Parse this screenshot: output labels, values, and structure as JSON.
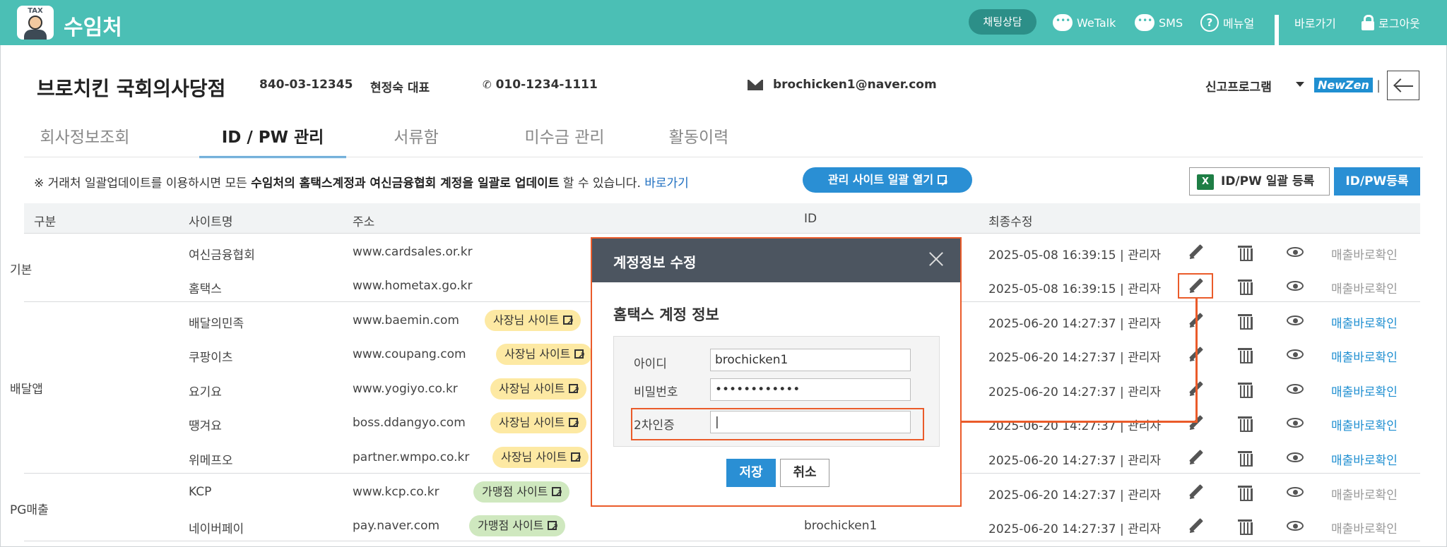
{
  "app": {
    "logo_text": "TAX",
    "title": "수임처",
    "nav": {
      "chat": "채팅상담",
      "wetalk": "WeTalk",
      "sms": "SMS",
      "manual": "메뉴얼",
      "shortcut": "바로가기",
      "logout": "로그아웃"
    }
  },
  "client": {
    "name": "브로치킨 국회의사당점",
    "biz_no": "840-03-12345",
    "rep": "현정숙 대표",
    "phone": "010-1234-1111",
    "email": "brochicken1@naver.com",
    "report_program": "신고프로그램",
    "newzen": "NewZen",
    "divider": "|"
  },
  "tabs": [
    "회사정보조회",
    "ID / PW 관리",
    "서류함",
    "미수금 관리",
    "활동이력"
  ],
  "notice": {
    "part1": "※ 거래처 일괄업데이트를 이용하시면 모든 ",
    "bold1": "수임처의 홈택스계정과 여신금융협회 계정을 일괄로 업데이트",
    "part2": " 할 수 있습니다. ",
    "link": "바로가기",
    "open_sites_btn": "관리 사이트 일괄 열기",
    "bulk_register_btn": "ID/PW 일괄 등록",
    "excel_icon": "X",
    "register_btn": "ID/PW등록"
  },
  "table": {
    "headers": [
      "구분",
      "사이트명",
      "주소",
      "ID",
      "최종수정"
    ],
    "groups": [
      {
        "name": "기본"
      },
      {
        "name": "배달앱"
      },
      {
        "name": "PG매출"
      }
    ],
    "rows": [
      {
        "site": "여신금융협회",
        "url": "www.cardsales.or.kr",
        "tag": "",
        "id": "",
        "modified": "2025-05-08 16:39:15 | 관리자",
        "sales": "매출바로확인",
        "sales_active": false
      },
      {
        "site": "홈택스",
        "url": "www.hometax.go.kr",
        "tag": "",
        "id": "",
        "modified": "2025-05-08 16:39:15 | 관리자",
        "sales": "매출바로확인",
        "sales_active": false
      },
      {
        "site": "배달의민족",
        "url": "www.baemin.com",
        "tag": "사장님 사이트",
        "id": "",
        "modified": "2025-06-20 14:27:37 | 관리자",
        "sales": "매출바로확인",
        "sales_active": true
      },
      {
        "site": "쿠팡이츠",
        "url": "www.coupang.com",
        "tag": "사장님 사이트",
        "id": "",
        "modified": "2025-06-20 14:27:37 | 관리자",
        "sales": "매출바로확인",
        "sales_active": true
      },
      {
        "site": "요기요",
        "url": "www.yogiyo.co.kr",
        "tag": "사장님 사이트",
        "id": "",
        "modified": "2025-06-20 14:27:37 | 관리자",
        "sales": "매출바로확인",
        "sales_active": true
      },
      {
        "site": "땡겨요",
        "url": "boss.ddangyo.com",
        "tag": "사장님 사이트",
        "id": "",
        "modified": "2025-06-20 14:27:37 | 관리자",
        "sales": "매출바로확인",
        "sales_active": true
      },
      {
        "site": "위메프오",
        "url": "partner.wmpo.co.kr",
        "tag": "사장님 사이트",
        "id": "",
        "modified": "2025-06-20 14:27:37 | 관리자",
        "sales": "매출바로확인",
        "sales_active": true
      },
      {
        "site": "KCP",
        "url": "www.kcp.co.kr",
        "tag": "가맹점 사이트",
        "id": "",
        "modified": "2025-06-20 14:27:37 | 관리자",
        "sales": "매출바로확인",
        "sales_active": false
      },
      {
        "site": "네이버페이",
        "url": "pay.naver.com",
        "tag": "가맹점 사이트",
        "id": "brochicken1",
        "modified": "2025-06-20 14:27:37 | 관리자",
        "sales": "매출바로확인",
        "sales_active": false
      }
    ]
  },
  "modal": {
    "title": "계정정보 수정",
    "subtitle": "홈택스 계정 정보",
    "id_label": "아이디",
    "id_value": "brochicken1",
    "pw_label": "비밀번호",
    "pw_value": "••••••••••••",
    "otp_label": "2차인증",
    "otp_value": "|",
    "save": "저장",
    "cancel": "취소"
  },
  "colors": {
    "topbar": "#4bbfb5",
    "accent_blue": "#2a8fd4",
    "highlight_orange": "#ea5b2a"
  }
}
